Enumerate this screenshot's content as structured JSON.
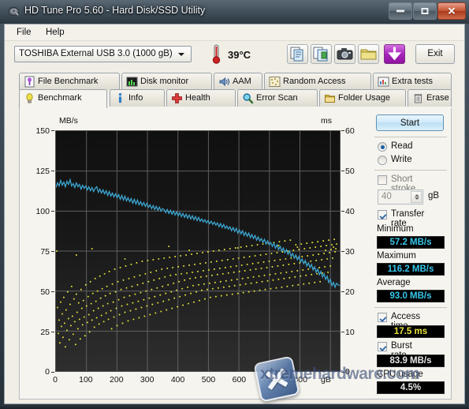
{
  "window": {
    "title": "HD Tune Pro 5.60 - Hard Disk/SSD Utility",
    "icon": "harddisk-icon",
    "minimize": "minimize-icon",
    "maximize": "maximize-icon",
    "close": "✕"
  },
  "menu": {
    "items": [
      {
        "label": "File",
        "name": "menu-file"
      },
      {
        "label": "Help",
        "name": "menu-help"
      }
    ]
  },
  "toolbar": {
    "drive": {
      "selected": "TOSHIBA External USB 3.0 (1000 gB)",
      "options": [
        "TOSHIBA External USB 3.0 (1000 gB)"
      ]
    },
    "temperature": "39°C",
    "buttons": [
      {
        "name": "copy-button",
        "icon": "copy-icon"
      },
      {
        "name": "copy-all-button",
        "icon": "copy-pages-icon"
      },
      {
        "name": "screenshot-button",
        "icon": "camera-icon"
      },
      {
        "name": "folder-button",
        "icon": "folder-gold-icon"
      },
      {
        "name": "save-button",
        "icon": "download-arrow-icon"
      }
    ],
    "exit_label": "Exit"
  },
  "tabs": {
    "row1": [
      {
        "label": "File Benchmark",
        "icon": "file-benchmark-icon",
        "active": false
      },
      {
        "label": "Disk monitor",
        "icon": "disk-monitor-icon",
        "active": false
      },
      {
        "label": "AAM",
        "icon": "speaker-icon",
        "active": false
      },
      {
        "label": "Random Access",
        "icon": "random-access-icon",
        "active": false
      },
      {
        "label": "Extra tests",
        "icon": "extra-tests-icon",
        "active": false
      }
    ],
    "row2": [
      {
        "label": "Benchmark",
        "icon": "lightbulb-icon",
        "active": true
      },
      {
        "label": "Info",
        "icon": "info-icon",
        "active": false
      },
      {
        "label": "Health",
        "icon": "health-cross-icon",
        "active": false
      },
      {
        "label": "Error Scan",
        "icon": "magnifier-icon",
        "active": false
      },
      {
        "label": "Folder Usage",
        "icon": "folder-icon",
        "active": false
      },
      {
        "label": "Erase",
        "icon": "trash-icon",
        "active": false
      }
    ]
  },
  "controls": {
    "start_label": "Start",
    "mode": [
      {
        "label": "Read",
        "selected": true
      },
      {
        "label": "Write",
        "selected": false
      }
    ],
    "short_stroke": {
      "label": "Short stroke",
      "checked": false,
      "value": "40",
      "unit": "gB"
    },
    "transfer_rate": {
      "label": "Transfer rate",
      "checked": true
    },
    "access_time": {
      "label": "Access time",
      "checked": true
    },
    "burst_rate": {
      "label": "Burst rate",
      "checked": true
    },
    "cpu_usage": {
      "label": "CPU usage"
    }
  },
  "results": {
    "minimum": {
      "label": "Minimum",
      "value": "57.2 MB/s"
    },
    "maximum": {
      "label": "Maximum",
      "value": "116.2 MB/s"
    },
    "average": {
      "label": "Average",
      "value": "93.0 MB/s"
    },
    "access_time": {
      "value": "17.5 ms"
    },
    "burst_rate": {
      "value": "83.9 MB/s"
    },
    "cpu_usage": {
      "value": "4.5%"
    }
  },
  "watermark": {
    "text": "xtremehardware.com",
    "logo": "x-logo"
  },
  "colors": {
    "transfer_line": "#3ca5d0",
    "access_dots": "#e8e33a",
    "plot_bg": "#1a1a1a",
    "grid": "#6a6a6a",
    "accent": "#37c6ea"
  },
  "chart_data": {
    "type": "line",
    "title": "",
    "xlabel": "gB",
    "ylabel": "MB/s",
    "y2label": "ms",
    "xlim": [
      0,
      931
    ],
    "ylim": [
      0,
      150
    ],
    "y2lim": [
      0,
      60
    ],
    "xticks": [
      0,
      100,
      200,
      300,
      400,
      500,
      600,
      700,
      800
    ],
    "yticks": [
      0,
      25,
      50,
      75,
      100,
      125,
      150
    ],
    "y2ticks": [
      0,
      10,
      20,
      30,
      40,
      50,
      60
    ],
    "grid": true,
    "series": [
      {
        "name": "Transfer rate",
        "axis": "left",
        "color": "#3ca5d0",
        "type": "line",
        "x": [
          0,
          20,
          40,
          60,
          80,
          100,
          120,
          140,
          160,
          180,
          200,
          220,
          240,
          260,
          280,
          300,
          320,
          340,
          360,
          380,
          400,
          420,
          440,
          460,
          480,
          500,
          520,
          540,
          560,
          580,
          600,
          620,
          640,
          660,
          680,
          700,
          720,
          740,
          760,
          780,
          800,
          820,
          840,
          860,
          880,
          900,
          920,
          931
        ],
        "values": [
          114.5,
          116.2,
          114.8,
          113.6,
          113.9,
          113.2,
          112.4,
          112.8,
          111.6,
          110.4,
          110.9,
          109.2,
          108.1,
          108.6,
          107.2,
          106.4,
          105.8,
          104.9,
          106.1,
          104.2,
          103.1,
          102.6,
          103.4,
          101.8,
          102.9,
          101.2,
          100.4,
          99.6,
          98.8,
          97.9,
          97.2,
          96.1,
          95.4,
          93.8,
          92.6,
          91.4,
          89.8,
          88.2,
          86.6,
          84.8,
          83.1,
          81.2,
          79.0,
          76.4,
          73.6,
          70.2,
          65.4,
          57.2
        ]
      },
      {
        "name": "Access time",
        "axis": "right",
        "color": "#e8e33a",
        "type": "scatter",
        "mean_ms": 17.5,
        "spread_ms": [
          2.0,
          22.0
        ],
        "note": "Dense scatter of ~900 samples, rising mean from ~8 ms near 0 gB to ~19 ms near 900 gB"
      }
    ],
    "summary": {
      "minimum_mbs": 57.2,
      "maximum_mbs": 116.2,
      "average_mbs": 93.0,
      "access_time_ms": 17.5,
      "burst_rate_mbs": 83.9,
      "cpu_usage_pct": 4.5
    }
  }
}
